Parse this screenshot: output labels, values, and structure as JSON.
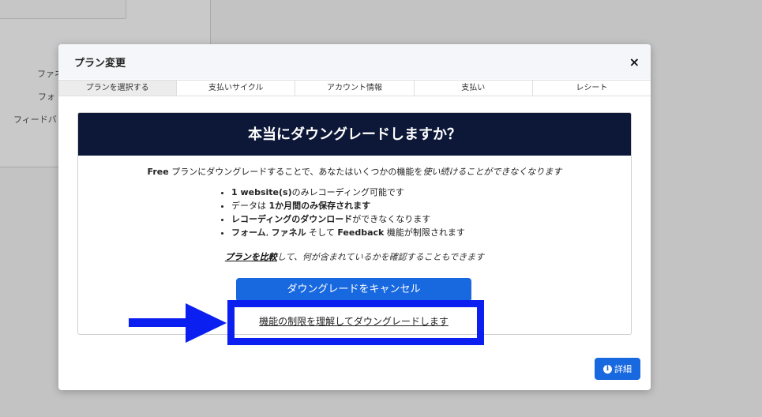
{
  "background": {
    "items": [
      "ファネ",
      "フォ",
      "フィードバッ"
    ]
  },
  "modal": {
    "title": "プラン変更",
    "close": "×",
    "steps": [
      "プランを選択する",
      "支払いサイクル",
      "アカウント情報",
      "支払い",
      "レシート"
    ],
    "card": {
      "heading": "本当にダウングレードしますか？",
      "intro": {
        "plan": "Free",
        "mid": " プランにダウングレードすることで、あなたはいくつかの機能を",
        "em": "使い続けることができなくなります"
      },
      "bullets": [
        {
          "bold": "1 website(s)",
          "rest": "のみレコーディング可能です"
        },
        {
          "pre": "データは ",
          "bold": "1か月間のみ保存されます"
        },
        {
          "bold": "レコーディングのダウンロード",
          "rest": "ができなくなります"
        },
        {
          "bold": "フォーム",
          "mid": ", ",
          "bold2": "ファネル",
          "mid2": " そして ",
          "bold3": "Feedback",
          "rest": " 機能が制限されます"
        }
      ],
      "compare_link": "プランを比較",
      "compare_rest": "して、何が含まれているかを確認することもできます",
      "cancel_button": "ダウングレードをキャンセル",
      "confirm_link": "機能の制限を理解してダウングレードします"
    },
    "detail_button": "詳細",
    "detail_icon": "info-icon"
  },
  "annotation": {
    "color": "#0a1ff0"
  }
}
